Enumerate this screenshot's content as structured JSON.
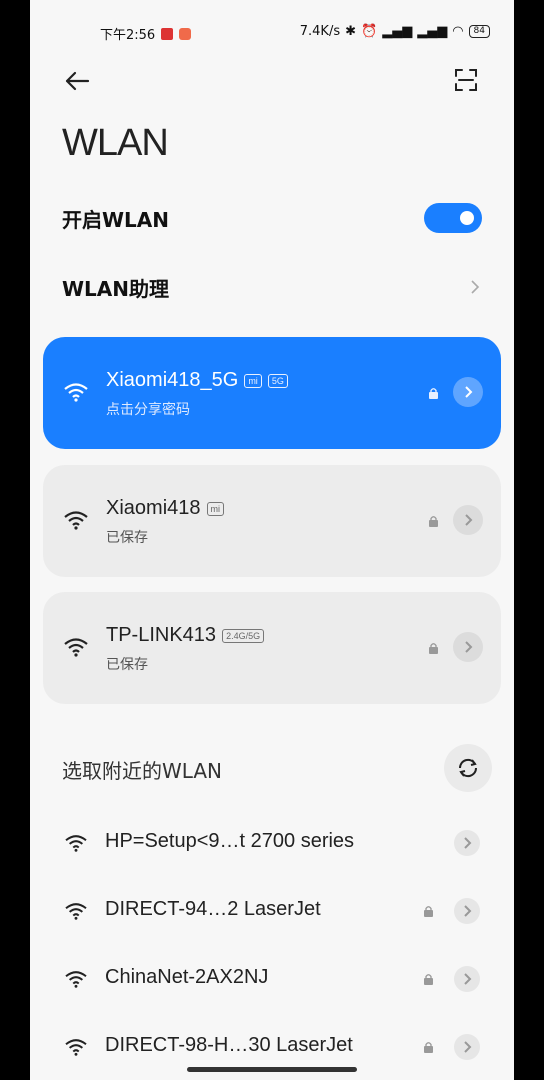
{
  "status": {
    "time": "下午2:56",
    "speed": "7.4K/s",
    "battery": "84"
  },
  "page": {
    "title": "WLAN"
  },
  "settings": {
    "wlan_toggle_label": "开启WLAN",
    "wlan_on": true,
    "assistant_label": "WLAN助理"
  },
  "saved_networks": [
    {
      "name": "Xiaomi418_5G",
      "tags": [
        "mi",
        "5G"
      ],
      "sub": "点击分享密码",
      "active": true
    },
    {
      "name": "Xiaomi418",
      "tags": [
        "mi"
      ],
      "sub": "已保存",
      "active": false
    },
    {
      "name": "TP-LINK413",
      "tags": [
        "2.4G/5G"
      ],
      "sub": "已保存",
      "active": false
    }
  ],
  "nearby": {
    "title": "选取附近的WLAN",
    "networks": [
      {
        "name": "HP=Setup<9…t 2700 series",
        "locked": false
      },
      {
        "name": "DIRECT-94…2 LaserJet",
        "locked": true
      },
      {
        "name": "ChinaNet-2AX2NJ",
        "locked": true
      },
      {
        "name": "DIRECT-98-H…30 LaserJet",
        "locked": true
      }
    ]
  },
  "colors": {
    "accent": "#1a7fff",
    "card_bg": "#ececec",
    "page_bg": "#f7f7f7"
  }
}
